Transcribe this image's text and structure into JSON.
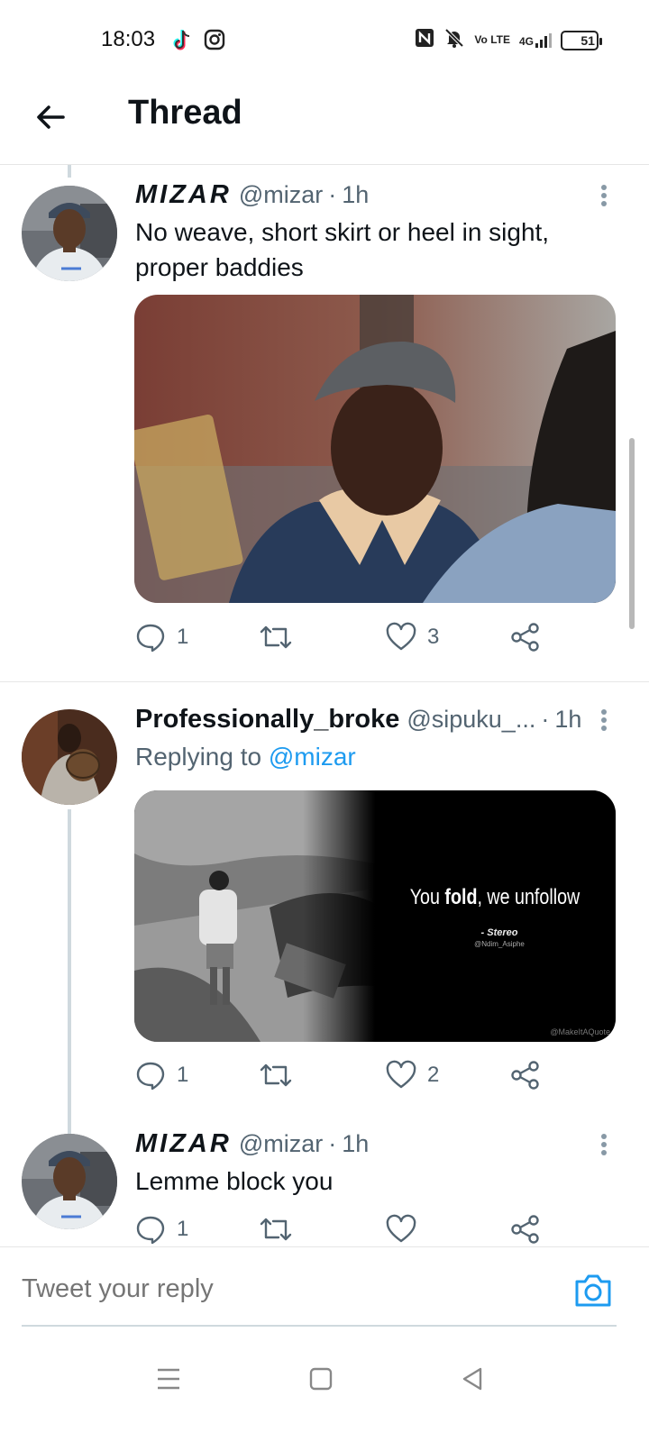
{
  "status_bar": {
    "time": "18:03",
    "network": "4G",
    "lte": "Vo LTE",
    "battery": "51",
    "battery_level": 0.51,
    "app_icons": [
      "tiktok-icon",
      "instagram-icon"
    ],
    "system_icons": [
      "nfc-icon",
      "mute-icon",
      "signal-icon",
      "battery-icon"
    ]
  },
  "header": {
    "title": "Thread",
    "back_icon": "arrow-left-icon"
  },
  "tweets": [
    {
      "display_name": "MIZAR",
      "handle": "@mizar",
      "time": "1h",
      "text": "No weave, short skirt or heel in sight, proper baddies",
      "replies": "1",
      "likes": "3"
    },
    {
      "display_name": "Professionally_broke",
      "handle": "@sipuku_...",
      "time": "1h",
      "replying_label": "Replying to",
      "replying_to": "@mizar",
      "image_quote": "You",
      "image_quote_bold": "fold",
      "image_quote_end": ", we unfollow",
      "image_credit": "- Stereo",
      "image_credit_sub": "@Ndim_Asiphe",
      "image_watermark": "@MakeItAQuote",
      "replies": "1",
      "likes": "2"
    },
    {
      "display_name": "MIZAR",
      "handle": "@mizar",
      "time": "1h",
      "text": "Lemme block you",
      "replies": "1",
      "likes": ""
    }
  ],
  "reply_bar": {
    "placeholder": "Tweet your reply",
    "camera_icon": "camera-icon"
  },
  "nav_bar": {
    "icons": [
      "menu-icon",
      "home-square-icon",
      "back-triangle-icon"
    ]
  },
  "colors": {
    "accent": "#1d9bf0",
    "muted": "#536471",
    "text": "#0f1419",
    "battery": "#f5d04a"
  }
}
